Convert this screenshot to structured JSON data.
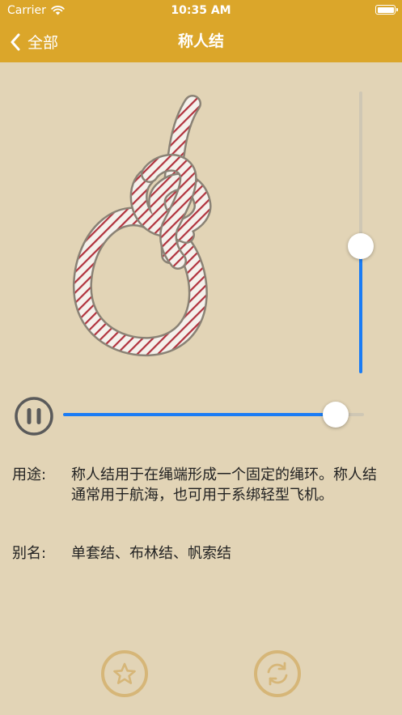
{
  "status_bar": {
    "carrier": "Carrier",
    "time": "10:35 AM"
  },
  "nav": {
    "back_label": "全部",
    "title": "称人结"
  },
  "speed_slider": {
    "value": 0.45
  },
  "progress_slider": {
    "value": 0.905
  },
  "usage": {
    "label": "用途:",
    "text": "称人结用于在绳端形成一个固定的绳环。称人结通常用于航海，也可用于系绑轻型飞机。"
  },
  "alias": {
    "label": "别名:",
    "text": "单套结、布林结、帆索结"
  },
  "icons": {
    "back": "chevron-left-icon",
    "pause": "pause-icon",
    "favorite": "star-icon",
    "repeat": "repeat-icon",
    "wifi": "wifi-icon",
    "battery": "battery-icon"
  },
  "colors": {
    "bar": "#dba62a",
    "background": "#e2d4b6",
    "accent": "#1a7cf5",
    "button_outline": "#d6b678"
  }
}
